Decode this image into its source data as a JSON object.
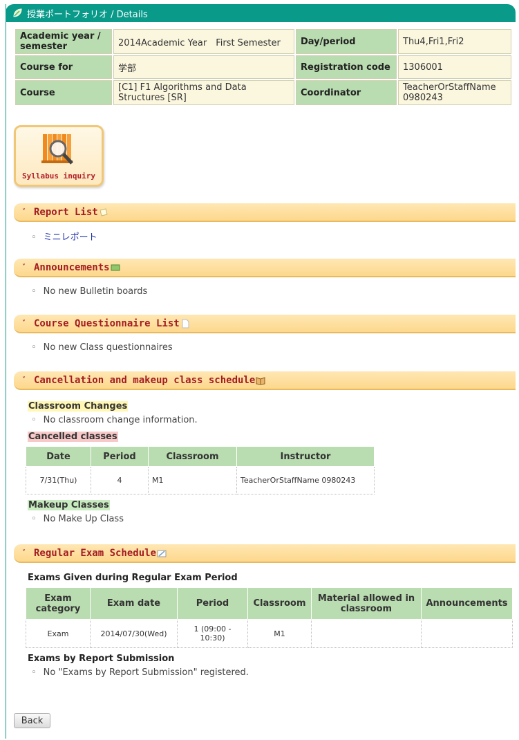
{
  "title": "授業ポートフォリオ / Details",
  "info": {
    "academic_year_label": "Academic year / semester",
    "academic_year_value": "2014Academic Year　First Semester",
    "day_period_label": "Day/period",
    "day_period_value": "Thu4,Fri1,Fri2",
    "course_for_label": "Course for",
    "course_for_value": "学部",
    "reg_code_label": "Registration code",
    "reg_code_value": "1306001",
    "course_label": "Course",
    "course_value": "[C1] F1 Algorithms and Data Structures [SR]",
    "coordinator_label": "Coordinator",
    "coordinator_value": "TeacherOrStaffName 0980243"
  },
  "syllabus_button": "Syllabus inquiry",
  "sections": {
    "report": {
      "title": "Report List",
      "item": "ミニレポート"
    },
    "announcements": {
      "title": "Announcements",
      "item": "No new Bulletin boards"
    },
    "questionnaire": {
      "title": "Course Questionnaire List",
      "item": "No new Class questionnaires"
    },
    "cancellation": {
      "title": "Cancellation and makeup class schedule",
      "classroom_changes": "Classroom Changes",
      "classroom_changes_item": "No classroom change information.",
      "cancelled": "Cancelled classes",
      "cancelled_headers": [
        "Date",
        "Period",
        "Classroom",
        "Instructor"
      ],
      "cancelled_row": [
        "7/31(Thu)",
        "4",
        "M1",
        "TeacherOrStaffName 0980243"
      ],
      "makeup": "Makeup Classes",
      "makeup_item": "No Make Up Class"
    },
    "exam": {
      "title": "Regular Exam Schedule",
      "regular_heading": "Exams Given during Regular Exam Period",
      "headers": [
        "Exam category",
        "Exam date",
        "Period",
        "Classroom",
        "Material allowed in classroom",
        "Announcements"
      ],
      "row": [
        "Exam",
        "2014/07/30(Wed)",
        "1 (09:00 - 10:30)",
        "M1",
        "",
        ""
      ],
      "report_heading": "Exams by Report Submission",
      "report_item": "No \"Exams by Report Submission\" registered."
    }
  },
  "back_button": "Back",
  "icons": {
    "title": "leaf-icon",
    "syllabus": "magnifier-books-icon",
    "report": "paper-icon",
    "announcements": "board-icon",
    "questionnaire": "document-icon",
    "cancellation": "book-icon",
    "exam": "pencil-note-icon"
  }
}
